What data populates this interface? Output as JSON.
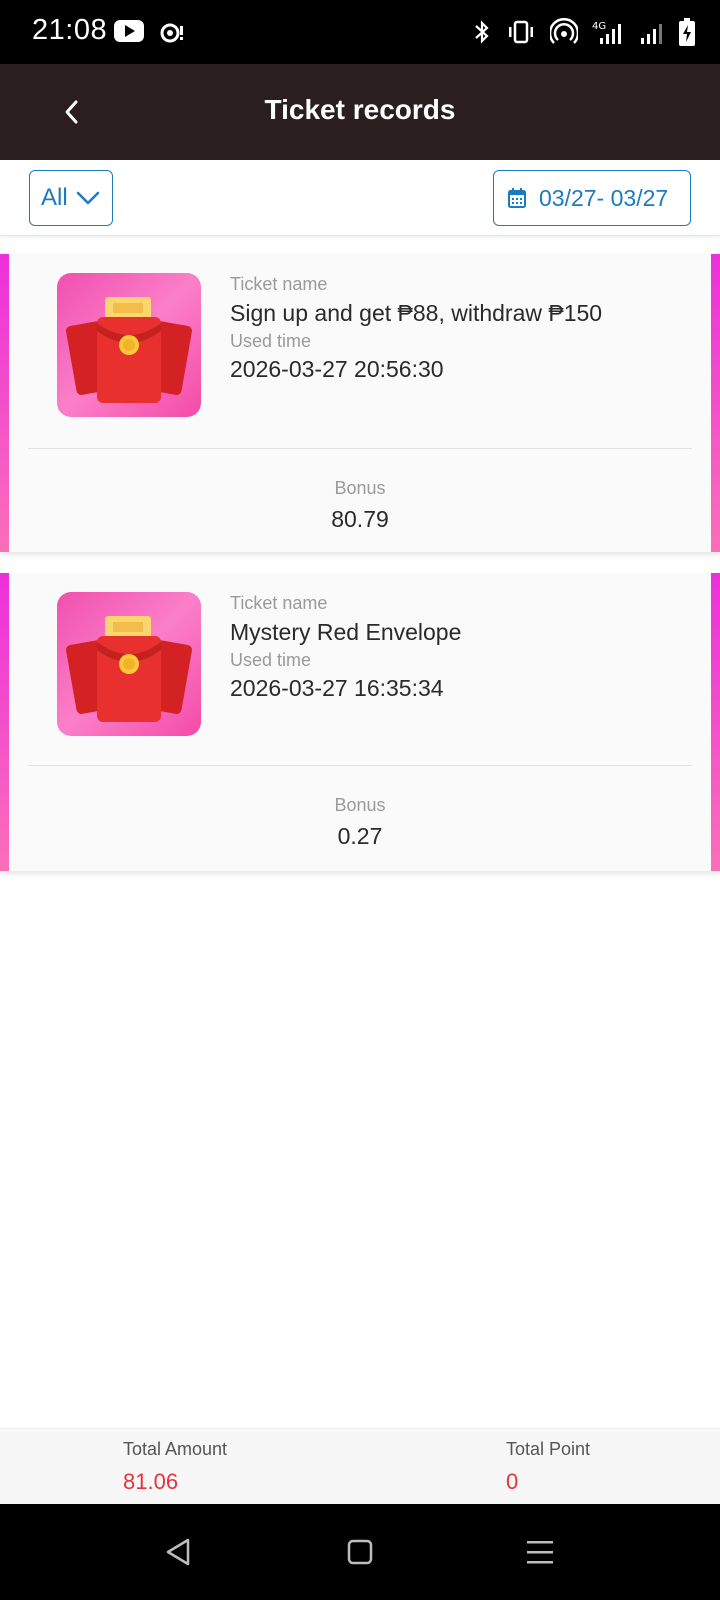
{
  "status_bar": {
    "time": "21:08",
    "icons": [
      "youtube-icon",
      "notification-icon",
      "bluetooth-icon",
      "vibrate-icon",
      "hotspot-icon",
      "signal-4g-icon",
      "signal-icon",
      "battery-charging-icon"
    ]
  },
  "header": {
    "title": "Ticket records",
    "back_icon": "back-arrow-icon"
  },
  "filters": {
    "type_selected": "All",
    "date_range": "03/27- 03/27"
  },
  "records": [
    {
      "name_label": "Ticket name",
      "name": "Sign up and get ₱88, withdraw ₱150",
      "time_label": "Used time",
      "time": "2026-03-27 20:56:30",
      "bonus_label": "Bonus",
      "bonus": "80.79",
      "icon": "red-envelope-icon"
    },
    {
      "name_label": "Ticket name",
      "name": "Mystery Red Envelope",
      "time_label": "Used time",
      "time": "2026-03-27 16:35:34",
      "bonus_label": "Bonus",
      "bonus": "0.27",
      "icon": "red-envelope-icon"
    }
  ],
  "totals": {
    "amount_label": "Total Amount",
    "amount": "81.06",
    "point_label": "Total Point",
    "point": "0"
  },
  "colors": {
    "header_bg": "#2a1e1e",
    "accent_blue": "#1b7bc0",
    "stripe_pink": "#ee2fdc",
    "total_red": "#e8323c"
  },
  "nav": [
    "back-nav-icon",
    "home-nav-icon",
    "menu-nav-icon"
  ]
}
